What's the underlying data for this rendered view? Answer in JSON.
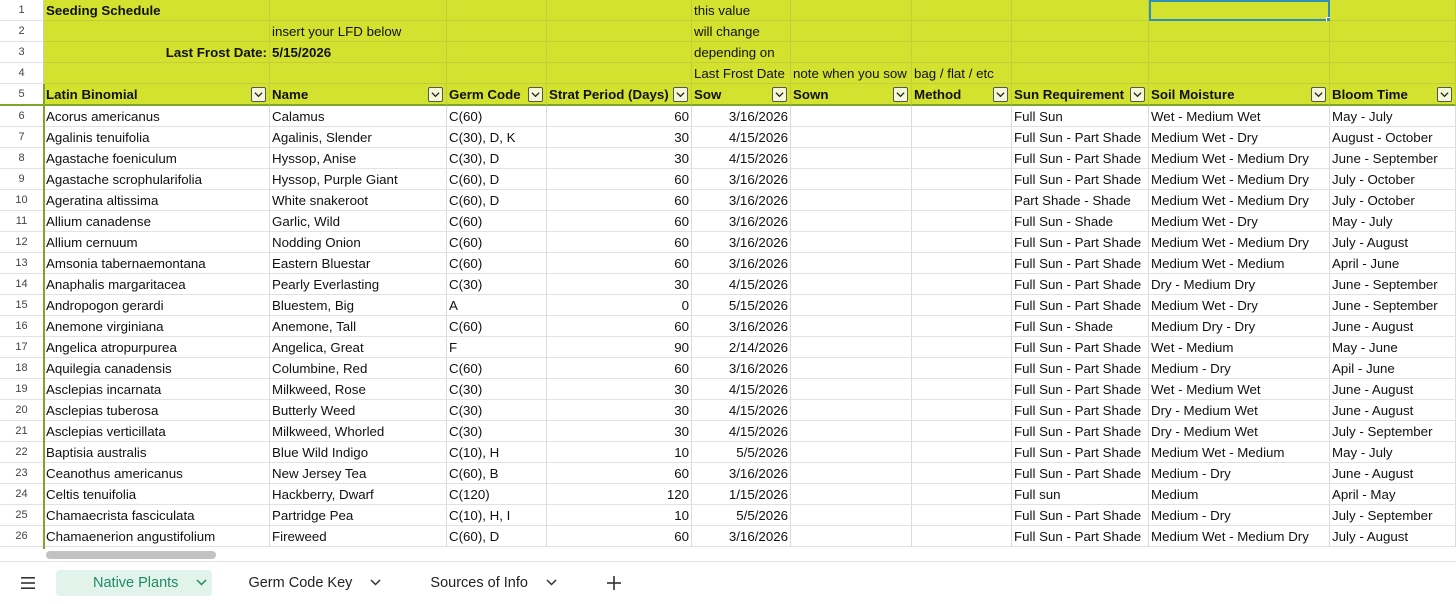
{
  "columns": [
    {
      "key": "A",
      "width": 226
    },
    {
      "key": "B",
      "width": 177
    },
    {
      "key": "C",
      "width": 100
    },
    {
      "key": "D",
      "width": 145
    },
    {
      "key": "E",
      "width": 99
    },
    {
      "key": "F",
      "width": 121
    },
    {
      "key": "G",
      "width": 100
    },
    {
      "key": "H",
      "width": 137
    },
    {
      "key": "I",
      "width": 181
    },
    {
      "key": "J",
      "width": 126
    }
  ],
  "top_rows": [
    {
      "num": "1",
      "cells": [
        "Seeding Schedule",
        "",
        "",
        "",
        "this value",
        "",
        "",
        "",
        "",
        ""
      ]
    },
    {
      "num": "2",
      "cells": [
        "",
        "insert your LFD below",
        "",
        "",
        "will change",
        "",
        "",
        "",
        "",
        ""
      ]
    },
    {
      "num": "3",
      "cells": [
        "Last Frost Date:",
        "5/15/2026",
        "",
        "",
        "depending on",
        "",
        "",
        "",
        "",
        ""
      ]
    },
    {
      "num": "4",
      "cells": [
        "",
        "",
        "",
        "",
        "Last Frost Date",
        "note when you sow",
        "bag / flat / etc",
        "",
        "",
        ""
      ]
    }
  ],
  "header": {
    "num": "5",
    "cells": [
      "Latin Binomial",
      "Name",
      "Germ Code",
      "Strat Period (Days)",
      "Sow",
      "Sown",
      "Method",
      "Sun Requirement",
      "Soil Moisture",
      "Bloom Time"
    ]
  },
  "rows": [
    {
      "num": "6",
      "cells": [
        "Acorus americanus",
        "Calamus",
        "C(60)",
        "60",
        "3/16/2026",
        "",
        "",
        "Full Sun",
        "Wet - Medium Wet",
        "May - July"
      ]
    },
    {
      "num": "7",
      "cells": [
        "Agalinis tenuifolia",
        "Agalinis, Slender",
        "C(30), D, K",
        "30",
        "4/15/2026",
        "",
        "",
        "Full Sun - Part Shade",
        "Medium Wet - Dry",
        "August - October"
      ]
    },
    {
      "num": "8",
      "cells": [
        "Agastache foeniculum",
        "Hyssop, Anise",
        "C(30), D",
        "30",
        "4/15/2026",
        "",
        "",
        "Full Sun - Part Shade",
        "Medium Wet - Medium Dry",
        "June - September"
      ]
    },
    {
      "num": "9",
      "cells": [
        "Agastache scrophularifolia",
        "Hyssop, Purple Giant",
        "C(60), D",
        "60",
        "3/16/2026",
        "",
        "",
        "Full Sun - Part Shade",
        "Medium Wet - Medium Dry",
        "July - October"
      ]
    },
    {
      "num": "10",
      "cells": [
        "Ageratina altissima",
        "White snakeroot",
        "C(60), D",
        "60",
        "3/16/2026",
        "",
        "",
        "Part Shade - Shade",
        "Medium Wet - Medium Dry",
        "July - October"
      ]
    },
    {
      "num": "11",
      "cells": [
        "Allium canadense",
        "Garlic, Wild",
        "C(60)",
        "60",
        "3/16/2026",
        "",
        "",
        "Full Sun - Shade",
        "Medium Wet - Dry",
        "May - July"
      ]
    },
    {
      "num": "12",
      "cells": [
        "Allium cernuum",
        "Nodding Onion",
        "C(60)",
        "60",
        "3/16/2026",
        "",
        "",
        "Full Sun - Part Shade",
        "Medium Wet - Medium Dry",
        "July - August"
      ]
    },
    {
      "num": "13",
      "cells": [
        "Amsonia tabernaemontana",
        "Eastern Bluestar",
        "C(60)",
        "60",
        "3/16/2026",
        "",
        "",
        "Full Sun - Part Shade",
        "Medium Wet - Medium",
        "April - June"
      ]
    },
    {
      "num": "14",
      "cells": [
        "Anaphalis margaritacea",
        "Pearly Everlasting",
        "C(30)",
        "30",
        "4/15/2026",
        "",
        "",
        "Full Sun - Part Shade",
        "Dry - Medium Dry",
        "June - September"
      ]
    },
    {
      "num": "15",
      "cells": [
        "Andropogon gerardi",
        "Bluestem, Big",
        "A",
        "0",
        "5/15/2026",
        "",
        "",
        "Full Sun - Part Shade",
        "Medium Wet - Dry",
        "June - September"
      ]
    },
    {
      "num": "16",
      "cells": [
        "Anemone virginiana",
        "Anemone, Tall",
        "C(60)",
        "60",
        "3/16/2026",
        "",
        "",
        "Full Sun - Shade",
        "Medium Dry - Dry",
        "June - August"
      ]
    },
    {
      "num": "17",
      "cells": [
        "Angelica atropurpurea",
        "Angelica, Great",
        "F",
        "90",
        "2/14/2026",
        "",
        "",
        "Full Sun - Part Shade",
        "Wet - Medium",
        "May - June"
      ]
    },
    {
      "num": "18",
      "cells": [
        "Aquilegia canadensis",
        "Columbine, Red",
        "C(60)",
        "60",
        "3/16/2026",
        "",
        "",
        "Full Sun - Part Shade",
        "Medium - Dry",
        "Apil - June"
      ]
    },
    {
      "num": "19",
      "cells": [
        "Asclepias incarnata",
        "Milkweed, Rose",
        "C(30)",
        "30",
        "4/15/2026",
        "",
        "",
        "Full Sun - Part Shade",
        "Wet - Medium Wet",
        "June - August"
      ]
    },
    {
      "num": "20",
      "cells": [
        "Asclepias tuberosa",
        "Butterly Weed",
        "C(30)",
        "30",
        "4/15/2026",
        "",
        "",
        "Full Sun - Part Shade",
        "Dry - Medium Wet",
        "June - August"
      ]
    },
    {
      "num": "21",
      "cells": [
        "Asclepias verticillata",
        "Milkweed, Whorled",
        "C(30)",
        "30",
        "4/15/2026",
        "",
        "",
        "Full Sun - Part Shade",
        "Dry - Medium Wet",
        "July - September"
      ]
    },
    {
      "num": "22",
      "cells": [
        "Baptisia australis",
        "Blue Wild Indigo",
        "C(10), H",
        "10",
        "5/5/2026",
        "",
        "",
        "Full Sun - Part Shade",
        "Medium Wet - Medium",
        "May - July"
      ]
    },
    {
      "num": "23",
      "cells": [
        "Ceanothus americanus",
        "New Jersey Tea",
        "C(60), B",
        "60",
        "3/16/2026",
        "",
        "",
        "Full Sun - Part Shade",
        "Medium - Dry",
        "June - August"
      ]
    },
    {
      "num": "24",
      "cells": [
        "Celtis tenuifolia",
        "Hackberry, Dwarf",
        "C(120)",
        "120",
        "1/15/2026",
        "",
        "",
        "Full sun",
        "Medium",
        "April - May"
      ]
    },
    {
      "num": "25",
      "cells": [
        "Chamaecrista fasciculata",
        "Partridge Pea",
        "C(10), H, I",
        "10",
        "5/5/2026",
        "",
        "",
        "Full Sun - Part Shade",
        "Medium - Dry",
        "July - September"
      ]
    },
    {
      "num": "26",
      "cells": [
        "Chamaenerion angustifolium",
        "Fireweed",
        "C(60), D",
        "60",
        "3/16/2026",
        "",
        "",
        "Full Sun - Part Shade",
        "Medium Wet - Medium Dry",
        "July - August"
      ]
    }
  ],
  "tabs": [
    {
      "label": "Native Plants",
      "active": true
    },
    {
      "label": "Germ Code Key",
      "active": false
    },
    {
      "label": "Sources of Info",
      "active": false
    }
  ],
  "icons": {
    "menu": "hamburger-menu-icon",
    "add": "plus-icon",
    "filter": "filter-dropdown-icon",
    "chevron": "chevron-down-icon"
  },
  "colors": {
    "header_fill": "#d3e22f",
    "accent_green": "#1e8a66",
    "selection": "#2f8fb5"
  }
}
